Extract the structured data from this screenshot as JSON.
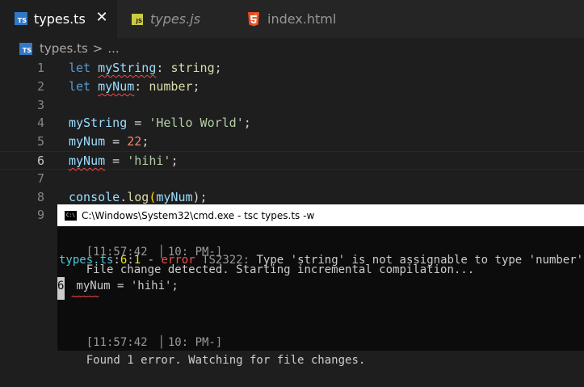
{
  "tabs": [
    {
      "label": "types.ts",
      "icon": "ts-icon",
      "active": true,
      "close_label": "✕"
    },
    {
      "label": "types.js",
      "icon": "js-icon",
      "active": false
    },
    {
      "label": "index.html",
      "icon": "html5-icon",
      "active": false
    }
  ],
  "breadcrumb": {
    "file": "types.ts",
    "separator": ">",
    "rest": "..."
  },
  "editor": {
    "line_numbers": [
      "1",
      "2",
      "3",
      "4",
      "5",
      "6",
      "7",
      "8",
      "9"
    ],
    "current_line": "6",
    "lines": [
      [
        {
          "t": "let ",
          "c": "kw"
        },
        {
          "t": "myString",
          "c": "var"
        },
        {
          "t": ": ",
          "c": "plain"
        },
        {
          "t": "string",
          "c": "typ-y"
        },
        {
          "t": ";",
          "c": "plain"
        }
      ],
      [
        {
          "t": "let ",
          "c": "kw"
        },
        {
          "t": "myNum",
          "c": "var"
        },
        {
          "t": ": ",
          "c": "plain"
        },
        {
          "t": "number",
          "c": "typ-y"
        },
        {
          "t": ";",
          "c": "plain"
        }
      ],
      [],
      [
        {
          "t": "myString",
          "c": "var"
        },
        {
          "t": " = ",
          "c": "plain"
        },
        {
          "t": "'Hello World'",
          "c": "str-g"
        },
        {
          "t": ";",
          "c": "plain"
        }
      ],
      [
        {
          "t": "myNum",
          "c": "var"
        },
        {
          "t": " = ",
          "c": "plain"
        },
        {
          "t": "22",
          "c": "num"
        },
        {
          "t": ";",
          "c": "plain"
        }
      ],
      [
        {
          "t": "myNum",
          "c": "var"
        },
        {
          "t": " = ",
          "c": "plain"
        },
        {
          "t": "'hihi'",
          "c": "str-g"
        },
        {
          "t": ";",
          "c": "plain"
        }
      ],
      [],
      [
        {
          "t": "console",
          "c": "var"
        },
        {
          "t": ".",
          "c": "plain"
        },
        {
          "t": "log",
          "c": "fn"
        },
        {
          "t": "(",
          "c": "yel"
        },
        {
          "t": "myNum",
          "c": "var"
        },
        {
          "t": ");",
          "c": "plain"
        }
      ],
      []
    ]
  },
  "cmd": {
    "title": "C:\\Windows\\System32\\cmd.exe - tsc  types.ts -w",
    "icon_text": "C:\\",
    "line1": {
      "time": "[11:57:42  ▏10: PM-]",
      "msg": "File change detected. Starting incremental compilation..."
    },
    "line2": {
      "file": "types.ts",
      "sep1": ":",
      "row": "6",
      "sep2": ":",
      "col": "1",
      "dash": " - ",
      "err": "error",
      "code": " TS2322:",
      "msg": " Type 'string' is not assignable to type 'number'."
    },
    "line3": {
      "num": "6",
      "code": " myNum = 'hihi';"
    },
    "tildes": "~~~~~",
    "line4": {
      "time": "[11:57:42  ▏10: PM-]",
      "msg": "Found 1 error. Watching for file changes."
    }
  },
  "colors": {
    "editor_bg": "#1e1e1e",
    "tab_active_fg": "#ffffff",
    "keyword": "#569cd6",
    "variable": "#9cdcfe",
    "type": "#dcdcaa",
    "error": "#f14c4c",
    "cmd_bg": "#0c0c0c"
  }
}
